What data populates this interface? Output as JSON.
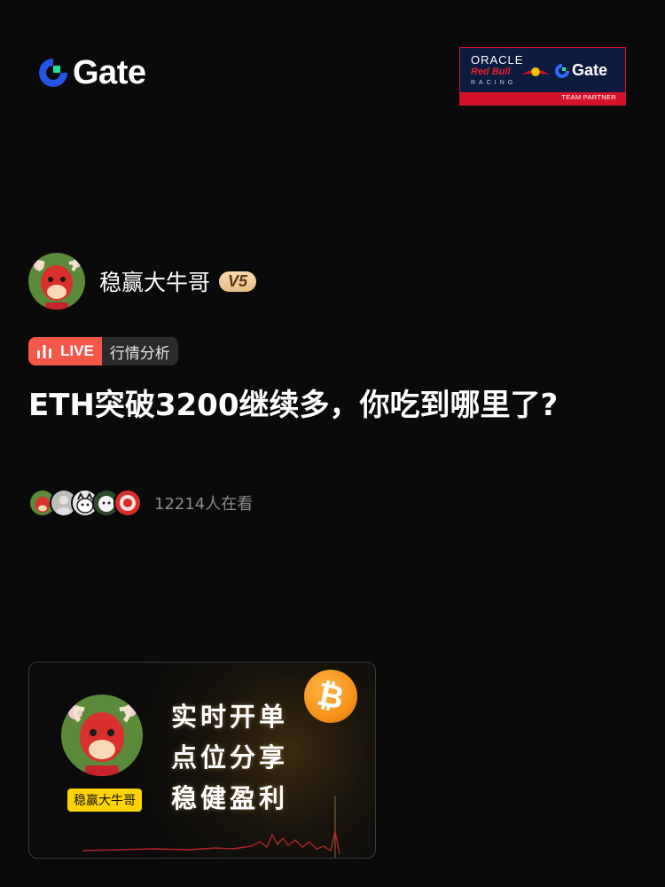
{
  "brand": {
    "name": "Gate"
  },
  "partner": {
    "oracle": "ORACLE",
    "red_bull": "Red Bull",
    "racing": "RACING",
    "gate": "Gate",
    "team_partner": "TEAM PARTNER"
  },
  "author": {
    "name": "稳赢大牛哥",
    "level": "V5"
  },
  "tags": {
    "live": "LIVE",
    "category": "行情分析"
  },
  "post": {
    "title": "ETH突破3200继续多，你吃到哪里了?"
  },
  "viewers": {
    "count_text": "12214人在看"
  },
  "card": {
    "label": "稳赢大牛哥",
    "lines": [
      "实时开单",
      "点位分享",
      "稳健盈利"
    ],
    "coin": "₿"
  },
  "colors": {
    "background": "#0a0a0a",
    "live_red": "#f5574b",
    "brand_blue": "#2354e6",
    "brand_green": "#17e6a1",
    "badge_gold": "#e8bd85",
    "card_label_yellow": "#ffd400",
    "bitcoin_orange": "#f7931a"
  }
}
